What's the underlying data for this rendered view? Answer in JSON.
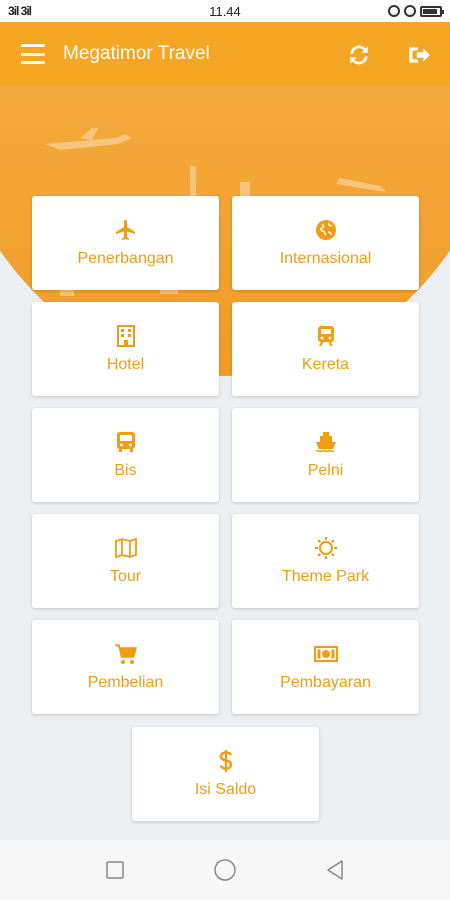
{
  "status_bar": {
    "signal": "3il 3il",
    "time": "11.44"
  },
  "app_bar": {
    "title": "Megatimor Travel"
  },
  "menu": [
    {
      "label": "Penerbangan",
      "icon": "airplane-icon"
    },
    {
      "label": "Internasional",
      "icon": "globe-icon"
    },
    {
      "label": "Hotel",
      "icon": "building-icon"
    },
    {
      "label": "Kereta",
      "icon": "train-icon"
    },
    {
      "label": "Bis",
      "icon": "bus-icon"
    },
    {
      "label": "Pelni",
      "icon": "ship-icon"
    },
    {
      "label": "Tour",
      "icon": "map-icon"
    },
    {
      "label": "Theme Park",
      "icon": "sun-icon"
    },
    {
      "label": "Pembelian",
      "icon": "cart-icon"
    },
    {
      "label": "Pembayaran",
      "icon": "money-icon"
    },
    {
      "label": "Isi Saldo",
      "icon": "dollar-icon"
    }
  ],
  "colors": {
    "primary": "#f5a623",
    "accent": "#f39c12",
    "background": "#eceff1"
  }
}
